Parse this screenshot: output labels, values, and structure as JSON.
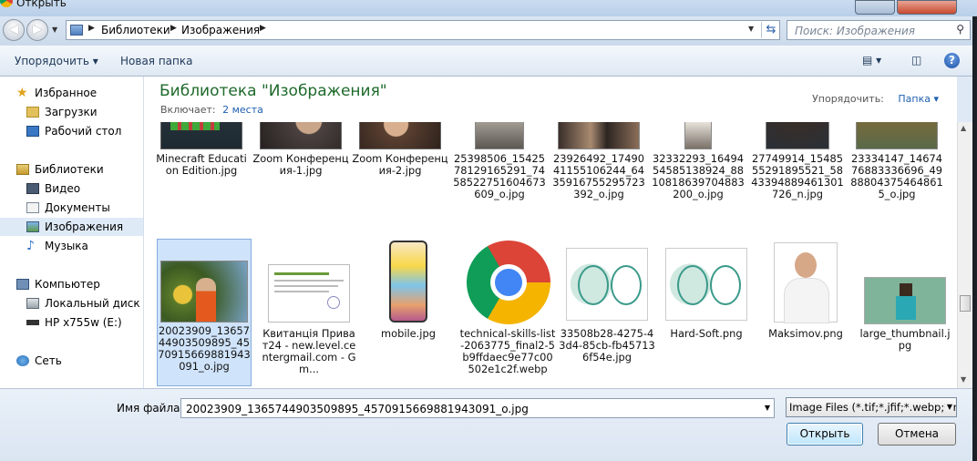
{
  "window": {
    "title": "Открыть"
  },
  "address": {
    "segments": [
      "Библиотеки",
      "Изображения"
    ]
  },
  "search": {
    "placeholder": "Поиск: Изображения"
  },
  "toolbar": {
    "organize": "Упорядочить ▾",
    "new_folder": "Новая папка"
  },
  "sidebar": {
    "favorites": "Избранное",
    "downloads": "Загрузки",
    "desktop": "Рабочий стол",
    "libraries": "Библиотеки",
    "video": "Видео",
    "documents": "Документы",
    "images": "Изображения",
    "music": "Музыка",
    "computer": "Компьютер",
    "local_disk": "Локальный диск (C",
    "hp": "HP x755w (E:)",
    "network": "Сеть"
  },
  "library": {
    "title": "Библиотека \"Изображения\"",
    "includes_label": "Включает:",
    "includes_link": "2 места",
    "arrange_label": "Упорядочить:",
    "arrange_value": "Папка ▾"
  },
  "files_row1": [
    {
      "name": "Minecraft Education Edition.jpg"
    },
    {
      "name": "Zoom Конференция-1.jpg"
    },
    {
      "name": "Zoom Конференция-2.jpg"
    },
    {
      "name": "25398506_1542578129165291_7458522751604673609_o.jpg"
    },
    {
      "name": "23926492_1749041155106244_6435916755295723392_o.jpg"
    },
    {
      "name": "32332293_1649454585138924_8810818639704883200_o.jpg"
    },
    {
      "name": "27749914_1548555291895521_5843394889461301726_n.jpg"
    },
    {
      "name": "23334147_1467476883336696_49888043754648615_o.jpg"
    }
  ],
  "files_row2": [
    {
      "name": "20023909_1365744903509895_4570915669881943091_o.jpg"
    },
    {
      "name": "Квитанція Приват24 - new.level.centergmail.com - Gm..."
    },
    {
      "name": "mobile.jpg"
    },
    {
      "name": "technical-skills-list-2063775_final2-5b9ffdaec9e77c00502e1c2f.webp"
    },
    {
      "name": "33508b28-4275-43d4-85cb-fb457136f54e.jpg"
    },
    {
      "name": "Hard-Soft.png"
    },
    {
      "name": "Maksimov.png"
    },
    {
      "name": "large_thumbnail.jpg"
    }
  ],
  "bottom": {
    "filename_label": "Имя файла:",
    "filename_value": "20023909_1365744903509895_4570915669881943091_o.jpg",
    "filter_value": "Image Files (*.tif;*.jfif;*.webp;*.r",
    "open_label": "Открыть",
    "cancel_label": "Отмена"
  }
}
